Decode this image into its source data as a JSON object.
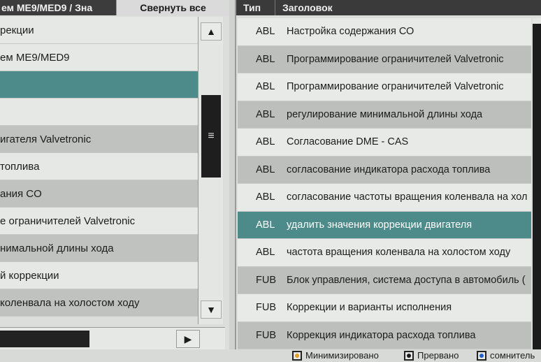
{
  "left": {
    "header_title": "ем ME9/MED9 / Зна",
    "collapse_all_label": "Свернуть все",
    "items": [
      {
        "label": "рекции",
        "style": "plain"
      },
      {
        "label": "ем ME9/MED9",
        "style": "plain"
      },
      {
        "label": "",
        "style": "selected"
      },
      {
        "label": "",
        "style": "plain"
      },
      {
        "label": "игателя Valvetronic",
        "style": "alt"
      },
      {
        "label": " топлива",
        "style": "plain"
      },
      {
        "label": "ания CO",
        "style": "alt"
      },
      {
        "label": "е ограничителей Valvetronic",
        "style": "plain"
      },
      {
        "label": "нимальной длины хода",
        "style": "alt"
      },
      {
        "label": "й коррекции",
        "style": "plain"
      },
      {
        "label": " коленвала на холостом ходу",
        "style": "alt"
      }
    ]
  },
  "right": {
    "col_type": "Тип",
    "col_title": "Заголовок",
    "rows": [
      {
        "type": "ABL",
        "title": "Настройка содержания СО",
        "style": "plain"
      },
      {
        "type": "ABL",
        "title": "Программирование ограничителей Valvetronic",
        "style": "alt"
      },
      {
        "type": "ABL",
        "title": "Программирование ограничителей Valvetronic",
        "style": "plain"
      },
      {
        "type": "ABL",
        "title": "регулирование минимальной длины хода",
        "style": "alt"
      },
      {
        "type": "ABL",
        "title": "Согласование DME - CAS",
        "style": "plain"
      },
      {
        "type": "ABL",
        "title": "согласование индикатора расхода топлива",
        "style": "alt"
      },
      {
        "type": "ABL",
        "title": "согласование частоты вращения коленвала на хол",
        "style": "plain"
      },
      {
        "type": "ABL",
        "title": "удалить значения коррекции двигателя",
        "style": "selected"
      },
      {
        "type": "ABL",
        "title": "частота вращения коленвала на холостом ходу",
        "style": "plain"
      },
      {
        "type": "FUB",
        "title": "Блок управления, система доступа в автомобиль (",
        "style": "alt"
      },
      {
        "type": "FUB",
        "title": "Коррекции и варианты исполнения",
        "style": "plain"
      },
      {
        "type": "FUB",
        "title": "Коррекция индикатора расхода топлива",
        "style": "alt"
      }
    ]
  },
  "status": {
    "legend": [
      {
        "label": "Минимизировано",
        "color": "#e0a020"
      },
      {
        "label": "Прервано",
        "color": "#1a1a1a"
      },
      {
        "label": "сомнитель",
        "color": "#1f5fd0"
      }
    ]
  },
  "icons": {
    "scroll_up": "▲",
    "scroll_down": "▼",
    "scroll_right": "▶",
    "grip": "≡"
  }
}
